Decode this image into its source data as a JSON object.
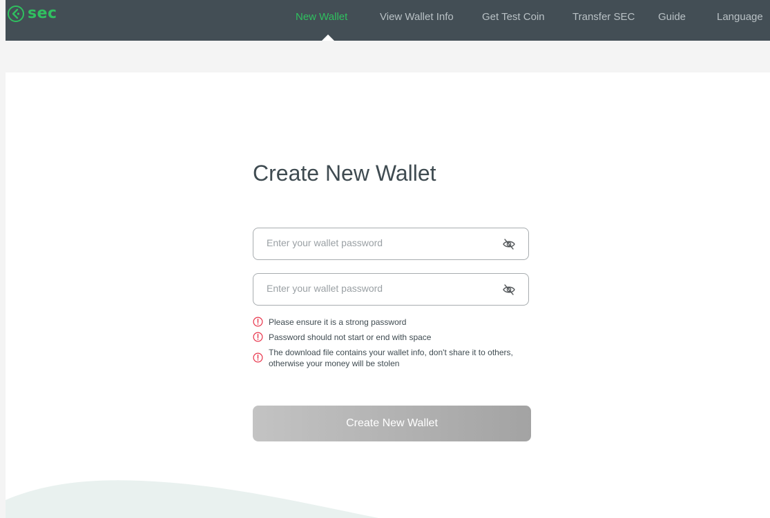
{
  "brand": {
    "name": "sec",
    "accent": "#2fc05f",
    "nav_bg": "#434e55"
  },
  "nav": {
    "items": [
      {
        "label": "New Wallet",
        "active": true
      },
      {
        "label": "View Wallet Info",
        "active": false
      },
      {
        "label": "Get Test Coin",
        "active": false
      },
      {
        "label": "Transfer SEC",
        "active": false
      },
      {
        "label": "Guide",
        "active": false
      },
      {
        "label": "Language",
        "active": false
      }
    ]
  },
  "form": {
    "title": "Create New Wallet",
    "password": {
      "placeholder": "Enter your wallet password",
      "value": "",
      "icon": "eye-off-icon"
    },
    "confirm_password": {
      "placeholder": "Enter your wallet password",
      "value": "",
      "icon": "eye-off-icon"
    },
    "notes": [
      "Please ensure it is a strong password",
      "Password should not start or end with space",
      "The download file contains your wallet info, don't share it to others, otherwise your money will be stolen"
    ],
    "warning_color": "#e8334a",
    "submit_label": "Create New Wallet",
    "submit_enabled": false
  }
}
